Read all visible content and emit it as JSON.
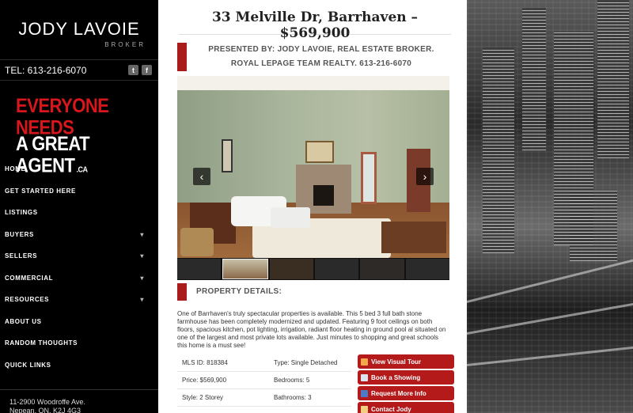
{
  "sidebar": {
    "brand_name": "JODY LAVOIE",
    "brand_subtitle": "BROKER",
    "phone": "TEL: 613-216-6070",
    "social": [
      "t",
      "f"
    ],
    "promo": {
      "line1": "EVERYONE NEEDS",
      "line2": "A GREAT AGENT",
      "suffix": ".CA"
    },
    "nav": [
      {
        "label": "HOME",
        "has_submenu": false
      },
      {
        "label": "GET STARTED HERE",
        "has_submenu": false
      },
      {
        "label": "LISTINGS",
        "has_submenu": false
      },
      {
        "label": "BUYERS",
        "has_submenu": true
      },
      {
        "label": "SELLERS",
        "has_submenu": true
      },
      {
        "label": "COMMERCIAL",
        "has_submenu": true
      },
      {
        "label": "RESOURCES",
        "has_submenu": true
      },
      {
        "label": "ABOUT US",
        "has_submenu": false
      },
      {
        "label": "RANDOM THOUGHTS",
        "has_submenu": false
      },
      {
        "label": "QUICK LINKS",
        "has_submenu": false
      }
    ],
    "address_line1": "11-2900 Woodroffe Ave.",
    "address_line2": "Nepean, ON, K2J 4G3"
  },
  "main": {
    "title": "33 Melville Dr, Barrhaven – $569,900",
    "presented_line1": "PRESENTED BY: JODY LAVOIE, REAL ESTATE BROKER.",
    "presented_line2": "ROYAL LEPAGE TEAM REALTY. 613-216-6070",
    "gallery": {
      "prev_icon": "‹",
      "next_icon": "›",
      "thumb_count": 6,
      "active_thumb": 2
    },
    "details_title": "PROPERTY DETAILS:",
    "description": "One of Barrhaven's truly spectacular properties is available. This 5 bed 3 full bath stone farmhouse has been completely modernized and updated. Featuring 9 foot ceilings on both floors, spacious kitchen, pot lighting, irrigation, radiant floor heating in ground pool al situated on one of the largest and most private lots available. Just minutes to shopping and great schools this home is a must see!",
    "facts": [
      [
        "MLS ID: 818384",
        "Type: Single Detached"
      ],
      [
        "Price: $569,900",
        "Bedrooms: 5"
      ],
      [
        "Style: 2 Storey",
        "Bathrooms: 3"
      ]
    ],
    "actions": [
      {
        "label": "View Visual Tour",
        "icon": "video"
      },
      {
        "label": "Book a Showing",
        "icon": "calendar"
      },
      {
        "label": "Request More Info",
        "icon": "info"
      },
      {
        "label": "Contact Jody",
        "icon": "envelope"
      }
    ]
  },
  "colors": {
    "accent_red": "#b41a1a",
    "promo_red": "#d8161c",
    "sidebar_bg": "#000000"
  }
}
